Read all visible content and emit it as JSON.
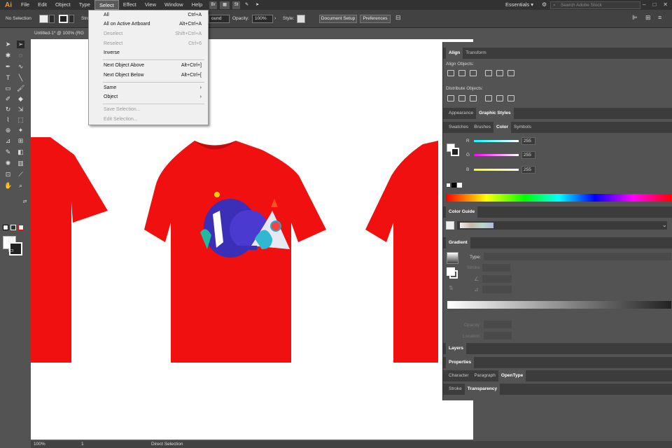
{
  "app": {
    "logo": "Ai",
    "workspace": "Essentials",
    "stock_placeholder": "Search Adobe Stock"
  },
  "menubar": {
    "items": [
      "File",
      "Edit",
      "Object",
      "Type",
      "Select",
      "Effect",
      "View",
      "Window",
      "Help"
    ],
    "active": "Select",
    "br": "Br",
    "st": "St"
  },
  "control": {
    "no_selection": "No Selection",
    "stroke_label": "Stro",
    "opacity_label": "Opacity:",
    "opacity_value": "100%",
    "style_label": "Style:",
    "round": "ound",
    "doc_setup": "Document Setup",
    "preferences": "Preferences"
  },
  "document_tab": "Untitled-1* @ 100% (RG",
  "select_menu": {
    "all": {
      "label": "All",
      "shortcut": "Ctrl+A"
    },
    "all_artboard": {
      "label": "All on Active Artboard",
      "shortcut": "Alt+Ctrl+A"
    },
    "deselect": {
      "label": "Deselect",
      "shortcut": "Shift+Ctrl+A"
    },
    "reselect": {
      "label": "Reselect",
      "shortcut": "Ctrl+6"
    },
    "inverse": {
      "label": "Inverse"
    },
    "next_above": {
      "label": "Next Object Above",
      "shortcut": "Alt+Ctrl+]"
    },
    "next_below": {
      "label": "Next Object Below",
      "shortcut": "Alt+Ctrl+["
    },
    "same": {
      "label": "Same",
      "arrow": "›"
    },
    "object": {
      "label": "Object",
      "arrow": "›"
    },
    "save_sel": {
      "label": "Save Selection..."
    },
    "edit_sel": {
      "label": "Edit Selection..."
    }
  },
  "panels": {
    "align_tabs": [
      "Align",
      "Transform"
    ],
    "align_objects": "Align Objects:",
    "distribute_objects": "Distribute Objects:",
    "appearance_tabs": [
      "Appearance",
      "Graphic Styles"
    ],
    "color_tabs": [
      "Swatches",
      "Brushes",
      "Color",
      "Symbols"
    ],
    "color": {
      "r_label": "R",
      "g_label": "G",
      "b_label": "B",
      "r": "255",
      "g": "255",
      "b": "255"
    },
    "color_guide": "Color Guide",
    "gradient": "Gradient",
    "gradient_type": "Type:",
    "gradient_stroke": "Stroke",
    "gradient_opacity": "Opacity",
    "gradient_location": "Location",
    "layers": "Layers",
    "properties": "Properties",
    "char_tabs": [
      "Character",
      "Paragraph",
      "OpenType"
    ],
    "stroke_tabs": [
      "Stroke",
      "Transparency"
    ]
  },
  "statusbar": {
    "zoom": "100%",
    "artboard": "1",
    "tool": "Direct Selection"
  },
  "colors": {
    "shirt": "#f01010",
    "accent": "#ff9a00"
  }
}
